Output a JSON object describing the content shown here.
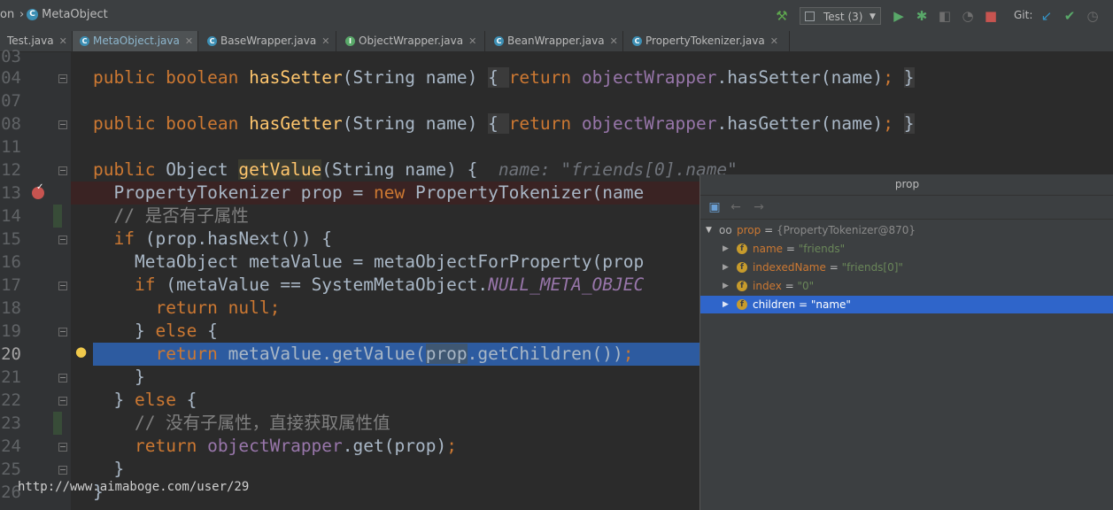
{
  "breadcrumb": {
    "parent": "on",
    "file": "MetaObject"
  },
  "toolbar": {
    "run_config": "Test (3)",
    "git_label": "Git:"
  },
  "tabs": [
    {
      "label": "Test.java"
    },
    {
      "label": "MetaObject.java",
      "active": true
    },
    {
      "label": "BaseWrapper.java"
    },
    {
      "label": "ObjectWrapper.java"
    },
    {
      "label": "BeanWrapper.java"
    },
    {
      "label": "PropertyTokenizer.java"
    }
  ],
  "gutter": {
    "line_numbers": [
      "03",
      "04",
      "07",
      "08",
      "11",
      "12",
      "13",
      "14",
      "15",
      "16",
      "17",
      "18",
      "19",
      "20",
      "21",
      "22",
      "23",
      "24",
      "25",
      "26"
    ]
  },
  "code": {
    "l2_a": "public boolean ",
    "l2_fn": "hasSetter",
    "l2_b": "(String name) ",
    "l2_c": "{ ",
    "l2_d": "return ",
    "l2_e": "objectWrapper",
    "l2_f": ".hasSetter(name)",
    "l2_g": "; ",
    "l2_h": "}",
    "l4_a": "public boolean ",
    "l4_fn": "hasGetter",
    "l4_b": "(String name) ",
    "l4_c": "{ ",
    "l4_d": "return ",
    "l4_e": "objectWrapper",
    "l4_f": ".hasGetter(name)",
    "l4_g": "; ",
    "l4_h": "}",
    "l6_a": "public ",
    "l6_b": "Object ",
    "l6_fn": "getValue",
    "l6_c": "(String name) {  ",
    "l6_hint": "name: \"friends[0].name\"",
    "l7_a": "  PropertyTokenizer prop = ",
    "l7_b": "new ",
    "l7_c": "PropertyTokenizer(name",
    "l8": "  // 是否有子属性",
    "l9_a": "  ",
    "l9_b": "if ",
    "l9_c": "(prop.hasNext()) {",
    "l10": "    MetaObject metaValue = metaObjectForProperty(prop",
    "l11_a": "    ",
    "l11_b": "if ",
    "l11_c": "(metaValue == SystemMetaObject.",
    "l11_d": "NULL_META_OBJEC",
    "l12_a": "      ",
    "l12_b": "return null",
    "l12_c": ";",
    "l13_a": "    } ",
    "l13_b": "else ",
    "l13_c": "{",
    "l14_a": "      ",
    "l14_b": "return ",
    "l14_c": "metaValue.getValue(",
    "l14_d": "prop",
    "l14_e": ".getChildren())",
    "l14_f": ";",
    "l15": "    }",
    "l16_a": "  } ",
    "l16_b": "else ",
    "l16_c": "{",
    "l17": "    // 没有子属性，直接获取属性值",
    "l18_a": "    ",
    "l18_b": "return ",
    "l18_c": "objectWrapper",
    "l18_d": ".get(prop)",
    "l18_e": ";",
    "l19": "  }",
    "l20": "}"
  },
  "debug_popup": {
    "title": "prop",
    "root": {
      "name": "prop",
      "value": "{PropertyTokenizer@870}"
    },
    "fields": [
      {
        "name": "name",
        "value": "\"friends\""
      },
      {
        "name": "indexedName",
        "value": "\"friends[0]\""
      },
      {
        "name": "index",
        "value": "\"0\""
      },
      {
        "name": "children",
        "value": "\"name\"",
        "selected": true
      }
    ]
  },
  "watermark": "http://www.aimaboge.com/user/29"
}
